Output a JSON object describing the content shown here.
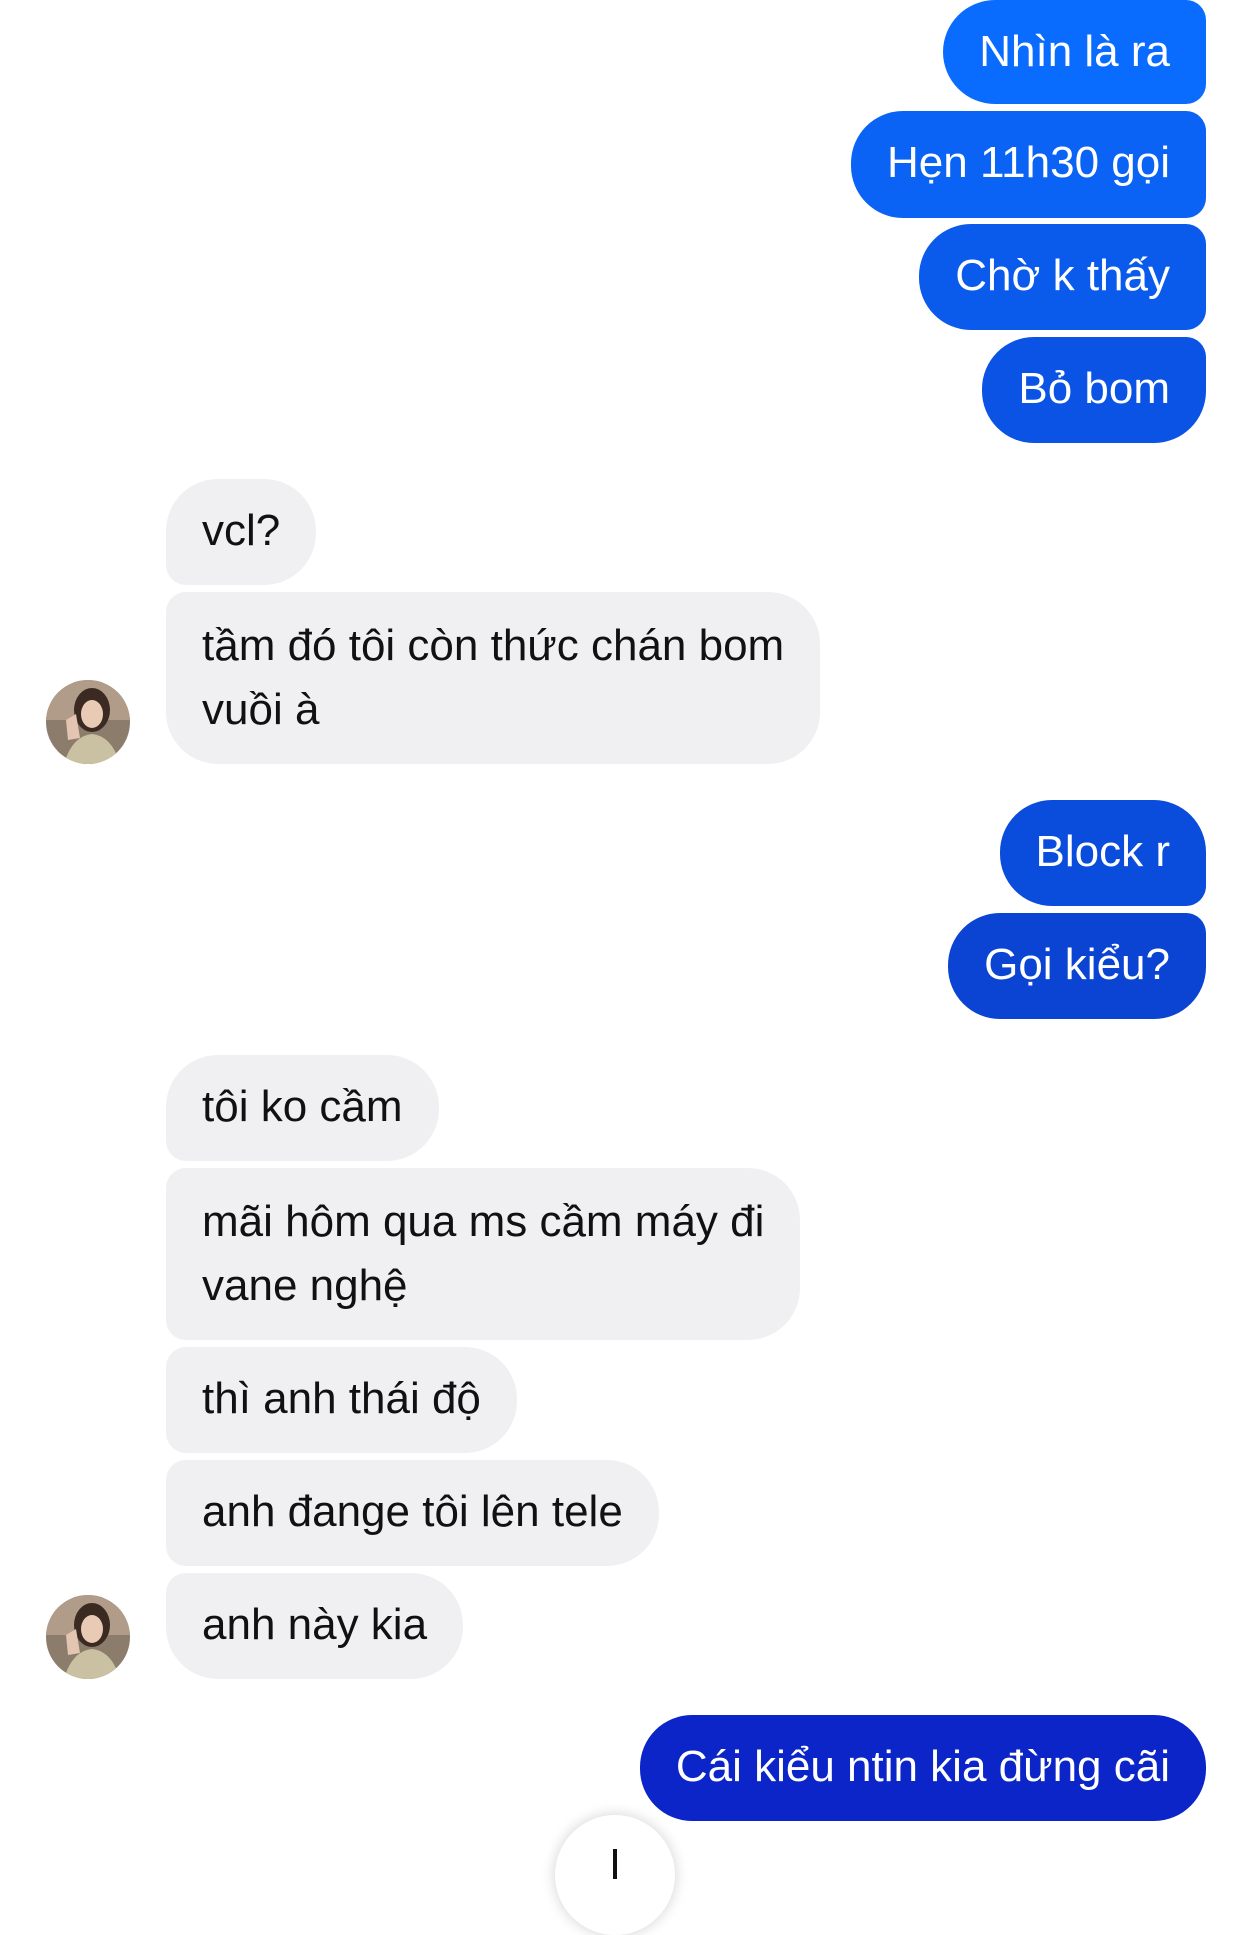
{
  "colors": {
    "outgoing_top": "#0a6cff",
    "outgoing_bottom": "#0b25c8",
    "incoming_bg": "#f0f0f3",
    "incoming_text": "#111111"
  },
  "messages": [
    {
      "dir": "out",
      "text": "Nhìn là ra"
    },
    {
      "dir": "out",
      "text": "Hẹn 11h30 gọi"
    },
    {
      "dir": "out",
      "text": "Chờ k thấy"
    },
    {
      "dir": "out",
      "text": "Bỏ bom"
    },
    {
      "dir": "in",
      "text": "vcl?"
    },
    {
      "dir": "in",
      "text": "tầm đó tôi còn thức chán bom\nvuồi à"
    },
    {
      "dir": "out",
      "text": "Block r"
    },
    {
      "dir": "out",
      "text": "Gọi kiểu?"
    },
    {
      "dir": "in",
      "text": "tôi ko cầm"
    },
    {
      "dir": "in",
      "text": "mãi hôm qua ms cầm máy đi\nvane nghệ"
    },
    {
      "dir": "in",
      "text": "thì anh thái độ"
    },
    {
      "dir": "in",
      "text": "anh đange tôi lên tele"
    },
    {
      "dir": "in",
      "text": "anh này kia"
    },
    {
      "dir": "out",
      "text": "Cái kiểu ntin kia đừng cãi"
    }
  ],
  "scroll_button": {
    "icon": "arrow-down-icon"
  }
}
